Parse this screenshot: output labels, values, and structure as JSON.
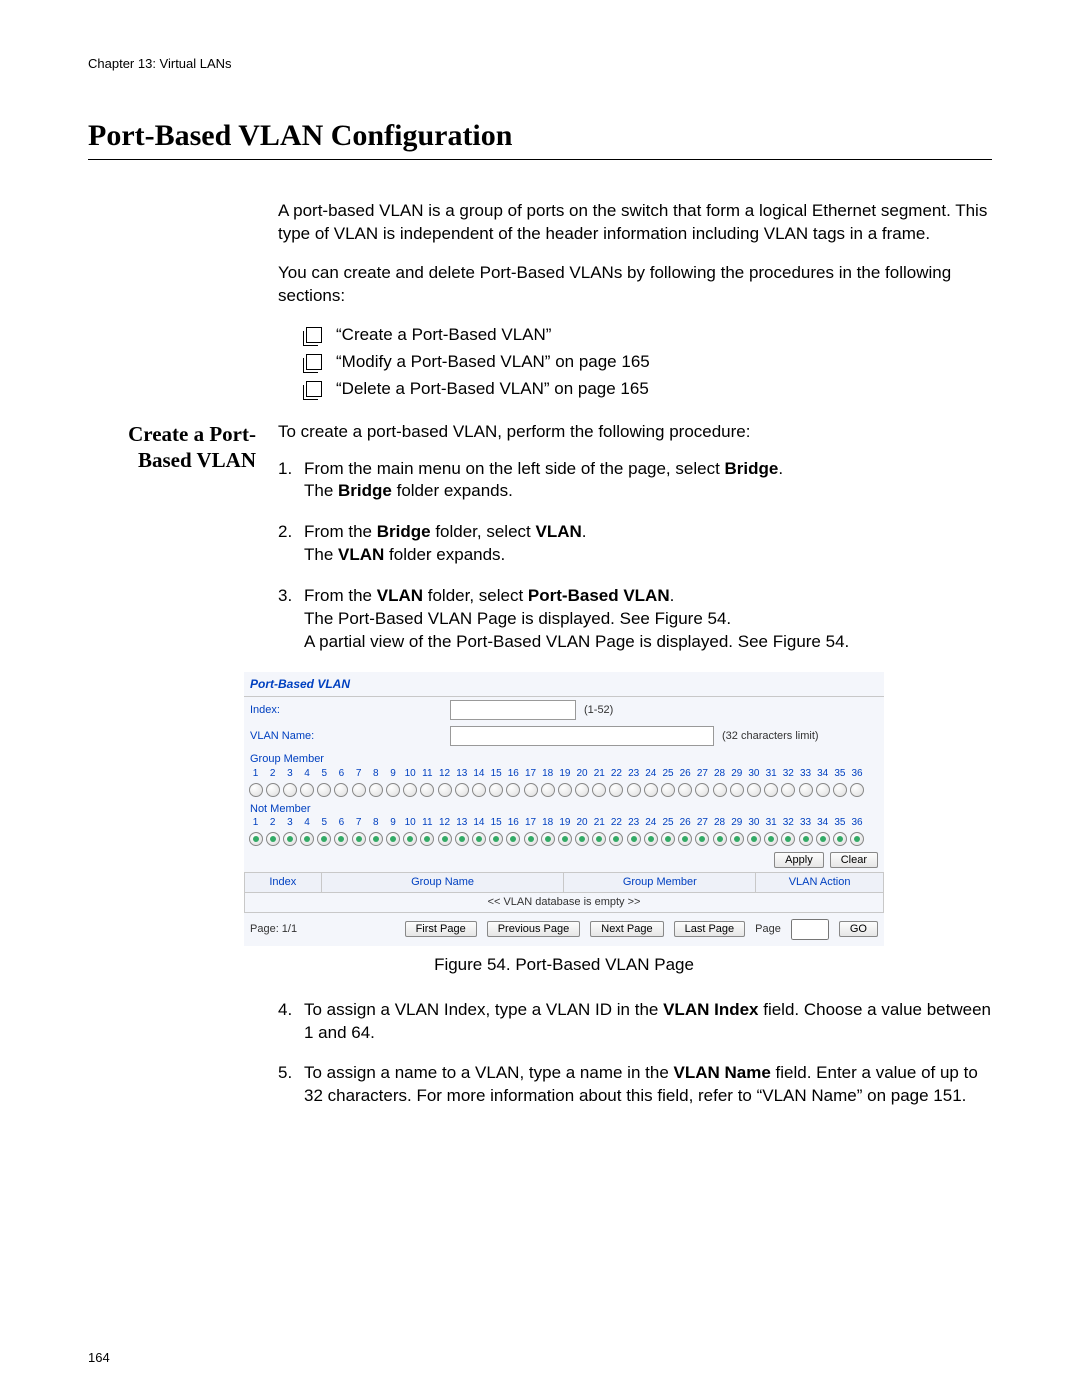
{
  "runningHead": "Chapter 13: Virtual LANs",
  "pageTitle": "Port-Based VLAN Configuration",
  "intro1": "A port-based VLAN is a group of ports on the switch that form a logical Ethernet segment. This type of VLAN is independent of the header information including VLAN tags in a frame.",
  "intro2": "You can create and delete Port-Based VLANs by following the procedures in the following sections:",
  "bullets": [
    "“Create a Port-Based VLAN”",
    "“Modify a Port-Based VLAN” on page 165",
    "“Delete a Port-Based VLAN” on page 165"
  ],
  "sideHeadingLine1": "Create a Port-",
  "sideHeadingLine2": "Based VLAN",
  "procIntro": "To create a port-based VLAN, perform the following procedure:",
  "steps": {
    "s1_a": "From the main menu on the left side of the page, select ",
    "s1_b": "Bridge",
    "s1_c": ".",
    "s1_d": "The ",
    "s1_e": "Bridge",
    "s1_f": " folder expands.",
    "s2_a": "From the ",
    "s2_b": "Bridge",
    "s2_c": " folder, select ",
    "s2_d": "VLAN",
    "s2_e": ".",
    "s2_f": "The ",
    "s2_g": "VLAN",
    "s2_h": " folder expands.",
    "s3_a": "From the ",
    "s3_b": "VLAN",
    "s3_c": " folder, select ",
    "s3_d": "Port-Based VLAN",
    "s3_e": ".",
    "s3_f": "The Port-Based VLAN Page is displayed. See Figure 54.",
    "s3_g": "A partial view of the Port-Based VLAN Page is displayed. See Figure 54.",
    "s4_a": "To assign a VLAN Index, type a VLAN ID in the ",
    "s4_b": "VLAN Index",
    "s4_c": " field. Choose a value between 1 and 64.",
    "s5_a": "To assign a name to a VLAN, type a name in the ",
    "s5_b": "VLAN Name",
    "s5_c": " field. Enter a value of up to 32 characters. For more information about this field, refer to “VLAN Name” on page 151."
  },
  "figureCaption": "Figure 54. Port-Based VLAN Page",
  "figure": {
    "panelTitle": "Port-Based VLAN",
    "indexLabel": "Index:",
    "indexHint": "(1-52)",
    "nameLabel": "VLAN Name:",
    "nameHint": "(32 characters limit)",
    "groupMember": "Group Member",
    "notMember": "Not Member",
    "applyBtn": "Apply",
    "clearBtn": "Clear",
    "colIndex": "Index",
    "colGroupName": "Group Name",
    "colGroupMember": "Group Member",
    "colVlanAction": "VLAN Action",
    "emptyMsg": "<< VLAN database is empty >>",
    "pageInfo": "Page: 1/1",
    "firstPage": "First Page",
    "prevPage": "Previous Page",
    "nextPage": "Next Page",
    "lastPage": "Last Page",
    "pageLabel": "Page",
    "goBtn": "GO"
  },
  "footerPageNum": "164"
}
